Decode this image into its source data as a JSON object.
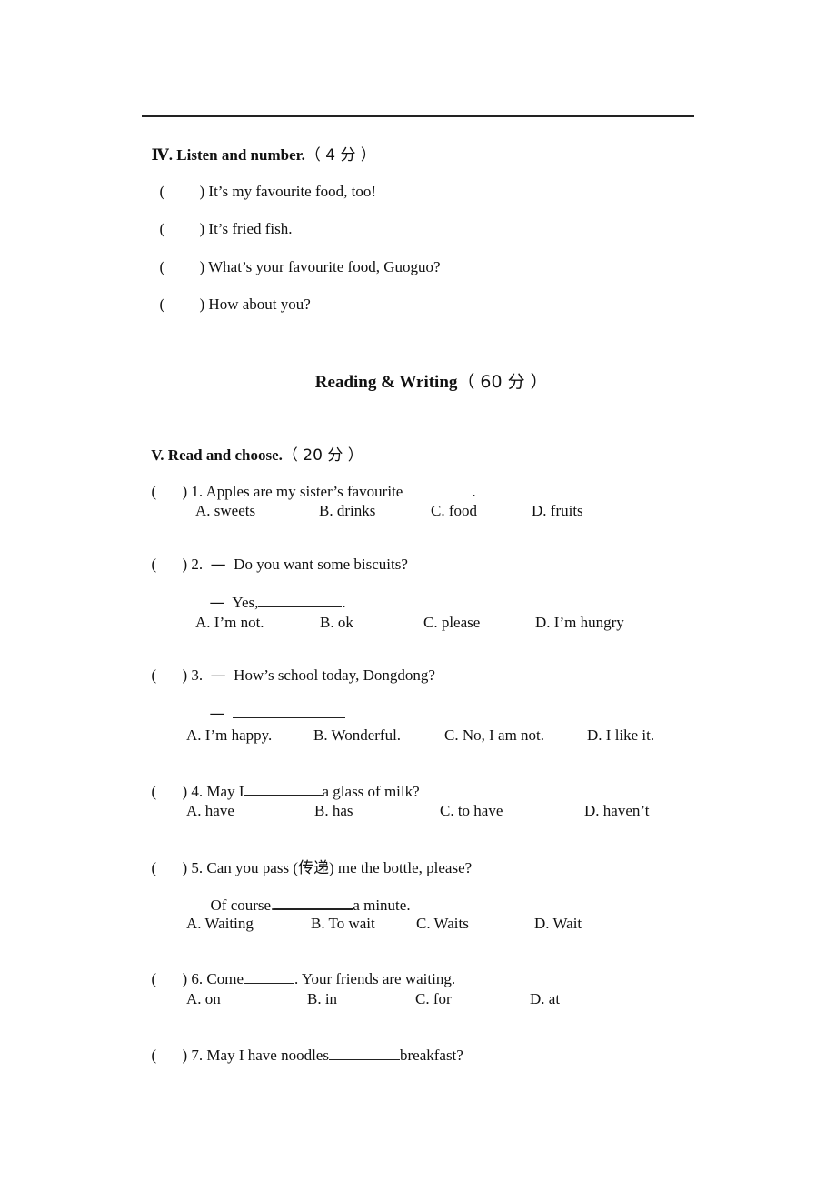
{
  "section4": {
    "title": "Ⅳ. Listen and number.",
    "score": "（ 4 分 ）",
    "items": [
      {
        "paren_open": "(",
        "paren_close": ")",
        "text": "It’s my favourite food, too!"
      },
      {
        "paren_open": "(",
        "paren_close": ")",
        "text": "It’s fried fish."
      },
      {
        "paren_open": "(",
        "paren_close": ")",
        "text": "What’s your favourite food, Guoguo?"
      },
      {
        "paren_open": "(",
        "paren_close": ")",
        "text": "How about you?"
      }
    ]
  },
  "part_title": {
    "text": "Reading & Writing",
    "score": "（ 60 分 ）"
  },
  "section5": {
    "title": "V. Read and choose.",
    "score": "（ 20 分 ）",
    "questions": [
      {
        "number": "1.",
        "text_before": "Apples are my sister’s favourite",
        "text_after": ".",
        "options": [
          "A. sweets",
          "B. drinks",
          "C. food",
          "D. fruits"
        ]
      },
      {
        "number": "2.",
        "dash": "—",
        "text": "Do you want some biscuits?",
        "reply_dash": "—",
        "reply_before": "Yes,",
        "reply_after": ".",
        "options": [
          "A. I’m not.",
          "B. ok",
          "C. please",
          "D. I’m hungry"
        ]
      },
      {
        "number": "3.",
        "dash": "—",
        "text": "How’s school today, Dongdong?",
        "reply_dash": "—",
        "options": [
          "A. I’m happy.",
          "B. Wonderful.",
          "C. No, I am not.",
          "D. I like it."
        ]
      },
      {
        "number": "4.",
        "text_before": "May I",
        "text_after": "a glass of milk?",
        "options": [
          "A. have",
          "B. has",
          "C. to have",
          "D. haven’t"
        ]
      },
      {
        "number": "5.",
        "text": "Can you pass (传递) me the bottle, please?",
        "reply_before": "Of course.",
        "reply_after": "a minute.",
        "options": [
          "A. Waiting",
          "B. To wait",
          "C. Waits",
          "D. Wait"
        ]
      },
      {
        "number": "6.",
        "text_before": "Come",
        "text_after": ". Your friends are waiting.",
        "options": [
          "A. on",
          "B. in",
          "C. for",
          "D. at"
        ]
      },
      {
        "number": "7.",
        "text_before": "May I have noodles",
        "text_after": "breakfast?"
      }
    ]
  }
}
